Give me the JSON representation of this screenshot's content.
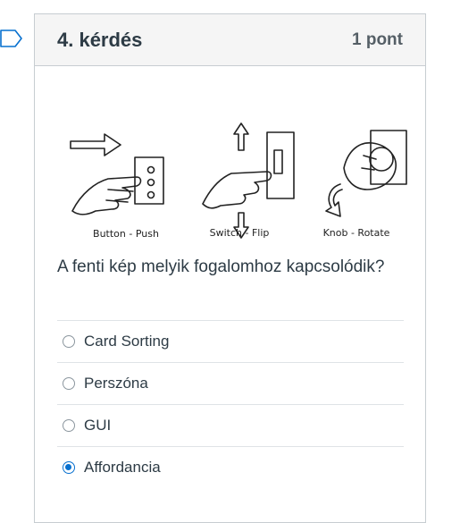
{
  "question": {
    "title": "4. kérdés",
    "points": "1 pont",
    "text": "A fenti kép melyik fogalomhoz kapcsolódik?",
    "figure_captions": [
      "Button - Push",
      "Switch - Flip",
      "Knob - Rotate"
    ],
    "answers": [
      {
        "label": "Card Sorting",
        "selected": false
      },
      {
        "label": "Perszóna",
        "selected": false
      },
      {
        "label": "GUI",
        "selected": false
      },
      {
        "label": "Affordancia",
        "selected": true
      }
    ]
  },
  "colors": {
    "accent": "#0770cf",
    "header_bg": "#f5f5f5",
    "border": "#c7cdd1"
  }
}
